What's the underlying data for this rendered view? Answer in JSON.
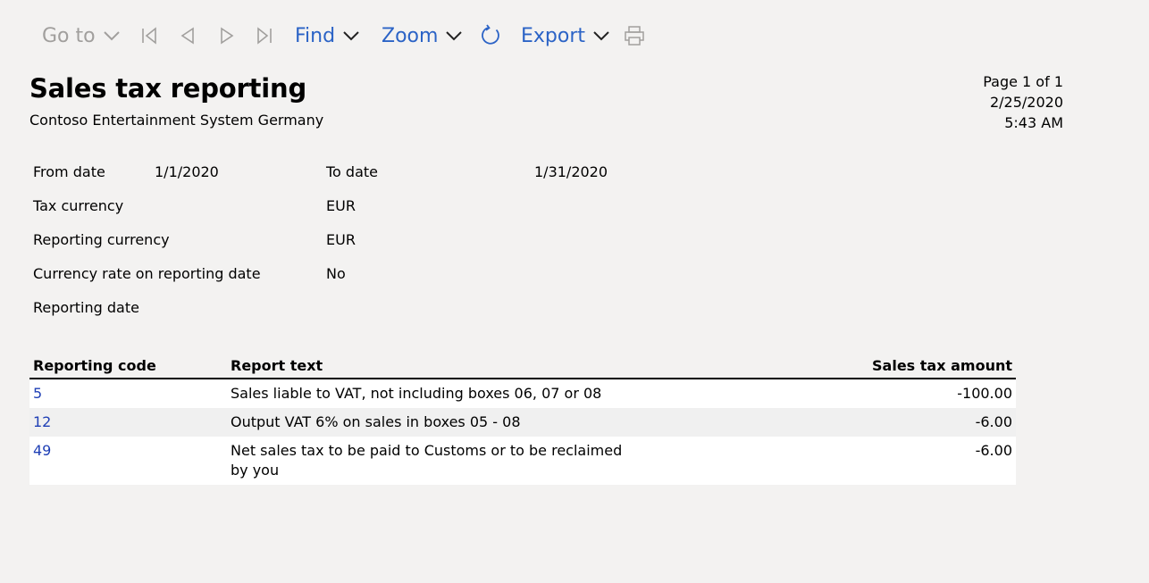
{
  "toolbar": {
    "goto_label": "Go to",
    "find_label": "Find",
    "zoom_label": "Zoom",
    "export_label": "Export"
  },
  "report": {
    "title": "Sales tax reporting",
    "company": "Contoso Entertainment System Germany",
    "page": "Page 1 of 1",
    "date": "2/25/2020",
    "time": "5:43 AM"
  },
  "params": {
    "from_date_label": "From date",
    "from_date_value": "1/1/2020",
    "to_date_label": "To date",
    "to_date_value": "1/31/2020",
    "tax_currency_label": "Tax currency",
    "tax_currency_value": "EUR",
    "reporting_currency_label": "Reporting currency",
    "reporting_currency_value": "EUR",
    "currency_rate_label": "Currency rate on reporting date",
    "currency_rate_value": "No",
    "reporting_date_label": "Reporting date"
  },
  "table": {
    "columns": [
      "Reporting code",
      "Report text",
      "Sales tax amount"
    ],
    "rows": [
      {
        "code": "5",
        "text": "Sales liable to VAT, not including boxes 06, 07 or 08",
        "amount": "-100.00"
      },
      {
        "code": "12",
        "text": "Output VAT 6% on sales in boxes 05 - 08",
        "amount": "-6.00"
      },
      {
        "code": "49",
        "text": "Net sales tax to be paid to Customs or to be reclaimed by you",
        "amount": "-6.00"
      }
    ]
  },
  "colors": {
    "background": "#f3f2f1",
    "accent": "#2b63c6",
    "link": "#1f3fb5",
    "disabled": "#a19f9d"
  },
  "icons": [
    "chevron-down-icon",
    "first-page-icon",
    "previous-page-icon",
    "next-page-icon",
    "last-page-icon",
    "refresh-icon",
    "print-icon"
  ]
}
